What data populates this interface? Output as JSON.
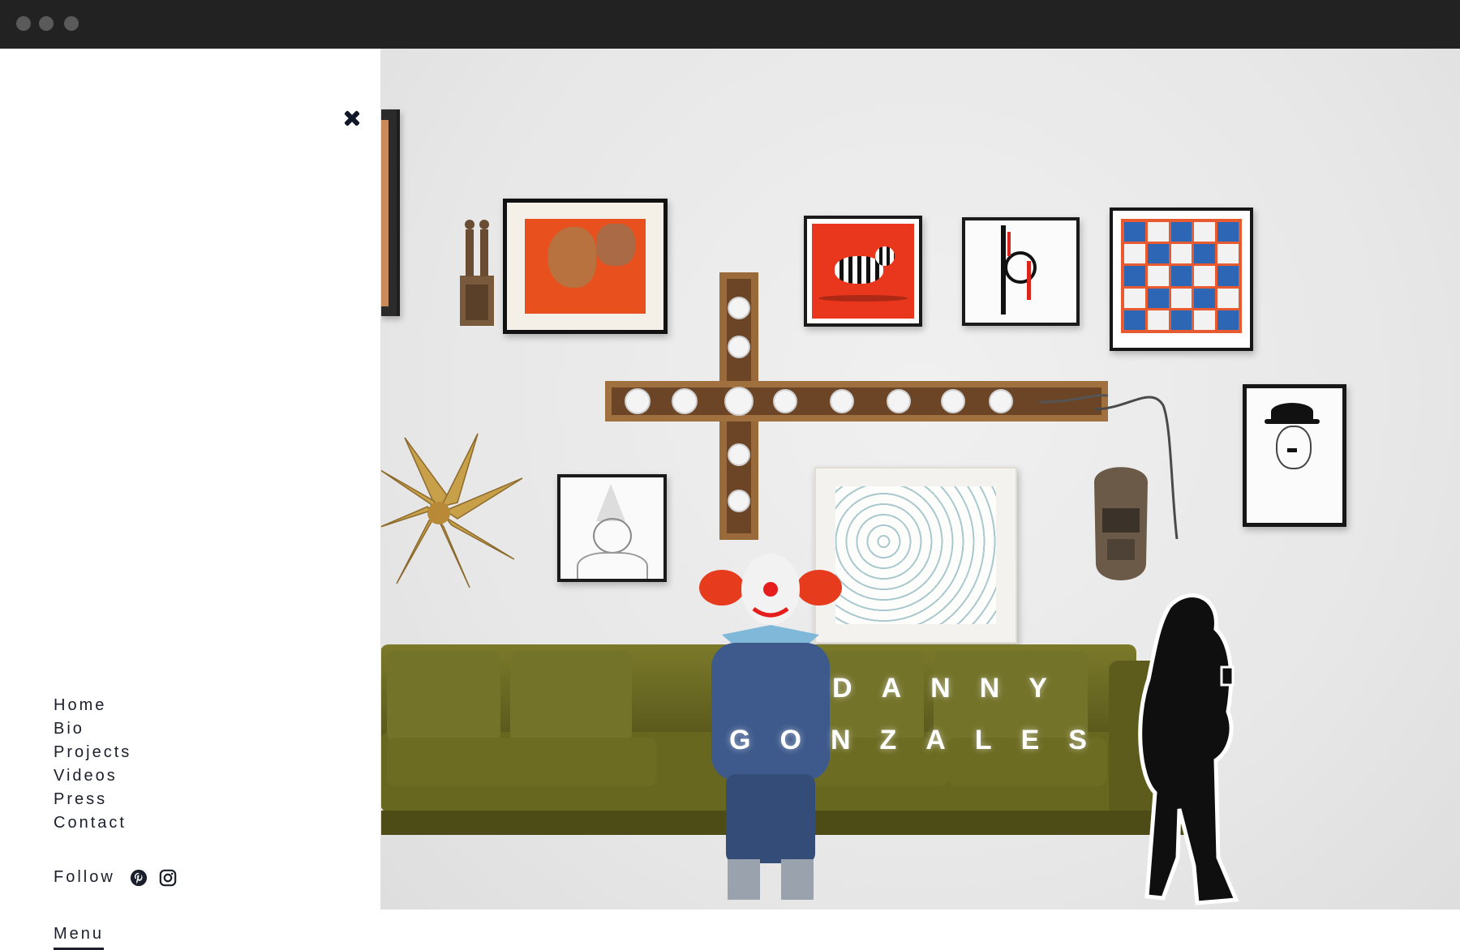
{
  "window": {
    "controls": [
      "close-dot",
      "minimize-dot",
      "maximize-dot"
    ]
  },
  "sidebar": {
    "nav_items": [
      {
        "label": "Home"
      },
      {
        "label": "Bio"
      },
      {
        "label": "Projects"
      },
      {
        "label": "Videos"
      },
      {
        "label": "Press"
      },
      {
        "label": "Contact"
      }
    ],
    "follow_label": "Follow",
    "social_icons": [
      "pinterest-icon",
      "instagram-icon"
    ],
    "menu_label": "Menu",
    "close_icon": "close-icon"
  },
  "hero": {
    "title_line1": "DANNY",
    "title_line2": "GONZALES"
  },
  "colors": {
    "chrome": "#222222",
    "sidebar_text": "#1b1f2b",
    "sofa": "#6b6a1f",
    "accent_red": "#e63b1d"
  }
}
